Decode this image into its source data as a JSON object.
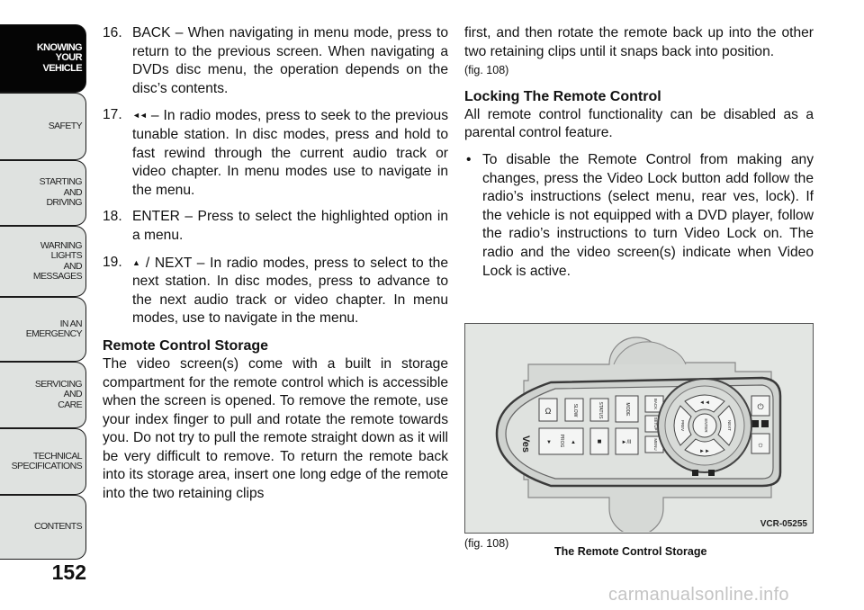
{
  "sidebar": {
    "tabs": [
      {
        "label": "KNOWING YOUR VEHICLE",
        "lines": [
          "KNOWING",
          "YOUR",
          "VEHICLE"
        ],
        "active": true
      },
      {
        "label": "SAFETY",
        "lines": [
          "SAFETY"
        ],
        "active": false
      },
      {
        "label": "STARTING AND DRIVING",
        "lines": [
          "STARTING",
          "AND",
          "DRIVING"
        ],
        "active": false
      },
      {
        "label": "WARNING LIGHTS AND MESSAGES",
        "lines": [
          "WARNING",
          "LIGHTS",
          "AND",
          "MESSAGES"
        ],
        "active": false
      },
      {
        "label": "IN AN EMERGENCY",
        "lines": [
          "IN AN",
          "EMERGENCY"
        ],
        "active": false
      },
      {
        "label": "SERVICING AND CARE",
        "lines": [
          "SERVICING",
          "AND",
          "CARE"
        ],
        "active": false
      },
      {
        "label": "TECHNICAL SPECIFICATIONS",
        "lines": [
          "TECHNICAL",
          "SPECIFICATIONS"
        ],
        "active": false
      },
      {
        "label": "CONTENTS",
        "lines": [
          "CONTENTS"
        ],
        "active": false
      }
    ]
  },
  "page_number": "152",
  "left_column": {
    "items": [
      {
        "number": "16.",
        "symbol": "",
        "text": "BACK – When navigating in menu mode, press to return to the previous screen. When navigating a DVDs disc menu, the operation depends on the disc’s contents."
      },
      {
        "number": "17.",
        "symbol": "◄◄",
        "text": " – In radio modes, press to seek to the previous tunable station. In disc modes, press and hold to fast rewind through the current audio track or video chapter. In menu modes use to navigate in the menu."
      },
      {
        "number": "18.",
        "symbol": "",
        "text": "ENTER – Press to select the highlighted option in a menu."
      },
      {
        "number": "19.",
        "symbol": "▲",
        "text": " / NEXT – In radio modes, press to select to the next station. In disc modes, press to advance to the next audio track or video chapter. In menu modes, use to navigate in the menu."
      }
    ],
    "section_heading": "Remote Control Storage",
    "section_paragraph": "The video screen(s) come with a built in storage compartment for the remote control which is acces­sible when the screen is opened. To remove the re­mote, use your index finger to pull and rotate the remote towards you. Do not try to pull the remote straight down as it will be very difficult to remove. To return the remote back into its storage area, insert one long edge of the remote into the two retaining clips"
  },
  "right_column": {
    "continuation": "first, and then rotate the remote back up into the other two retaining clips until it snaps back into position.",
    "figure_ref": "(fig.  108)",
    "section_heading": "Locking The Remote Control",
    "section_paragraph": "All remote control functionality can be disabled as a parental control feature.",
    "bullets": [
      "To disable the Remote Control from making any changes, press the Video Lock button add follow the radio’s instructions (select menu, rear ves, lock). If the vehicle is not equipped with a DVD player, follow the radio’s instructions to turn Video Lock on. The radio and the video screen(s) indicate when Video Lock is active."
    ]
  },
  "figure": {
    "code": "VCR-05255",
    "caption_ref": "(fig. 108)",
    "caption": "The Remote Control Storage",
    "remote_buttons": {
      "logo": "Ves",
      "slow": "SLOW",
      "status": "STATUS",
      "mode": "MODE",
      "back": "BACK",
      "setup": "SETUP",
      "menu": "MENU",
      "prog": "PROG",
      "play_pause": "►/II",
      "stop": "■",
      "prev": "PREV",
      "next": "NEXT",
      "enter": "ENTER"
    }
  },
  "watermark": "carmanualsonline.info"
}
